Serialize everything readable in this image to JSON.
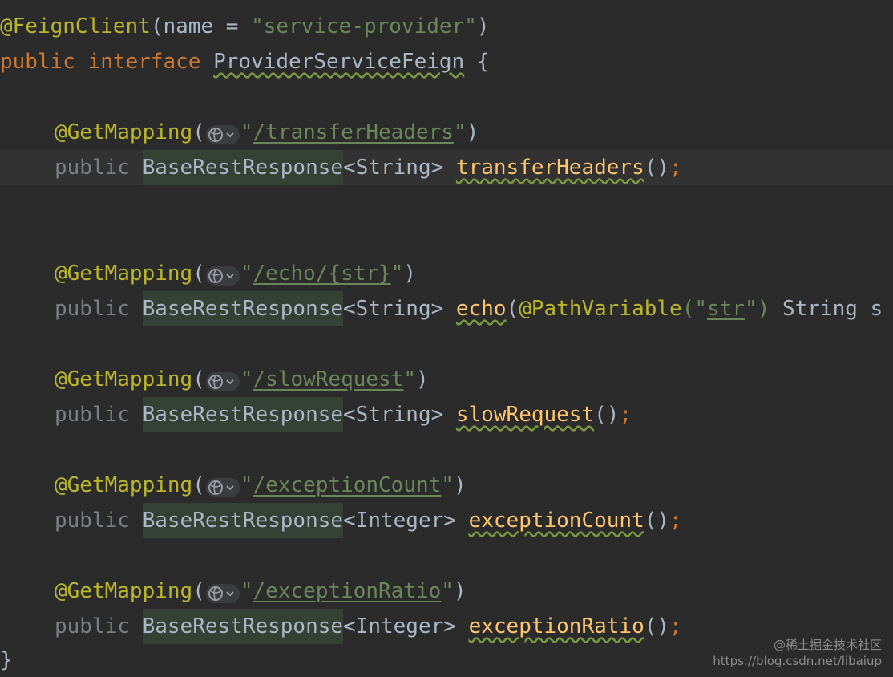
{
  "code": {
    "l1": {
      "anno": "@FeignClient",
      "open": "(",
      "param": "name",
      "eq": " = ",
      "value": "\"service-provider\"",
      "close": ")"
    },
    "l2": {
      "kw1": "public",
      "kw2": "interface",
      "name": "ProviderServiceFeign",
      "brace": " {"
    },
    "methods": [
      {
        "anno": "@GetMapping",
        "path_open": "\"",
        "path": "/transferHeaders",
        "path_close": "\"",
        "mod": "public",
        "ret": "BaseRestResponse",
        "generic": "<String>",
        "name": "transferHeaders",
        "args": "()",
        "semi": ";"
      },
      {
        "anno": "@GetMapping",
        "path_open": "\"",
        "path": "/echo/{str}",
        "path_close": "\"",
        "mod": "public",
        "ret": "BaseRestResponse",
        "generic": "<String>",
        "name": "echo",
        "args_open": "(",
        "param_anno": "@PathVariable",
        "param_q1": "(\"",
        "param_val": "str",
        "param_q2": "\")",
        "param_type": " String s"
      },
      {
        "anno": "@GetMapping",
        "path_open": "\"",
        "path": "/slowRequest",
        "path_close": "\"",
        "mod": "public",
        "ret": "BaseRestResponse",
        "generic": "<String>",
        "name": "slowRequest",
        "args": "()",
        "semi": ";"
      },
      {
        "anno": "@GetMapping",
        "path_open": "\"",
        "path": "/exceptionCount",
        "path_close": "\"",
        "mod": "public",
        "ret": "BaseRestResponse",
        "generic": "<Integer>",
        "name": "exceptionCount",
        "args": "()",
        "semi": ";"
      },
      {
        "anno": "@GetMapping",
        "path_open": "\"",
        "path": "/exceptionRatio",
        "path_close": "\"",
        "mod": "public",
        "ret": "BaseRestResponse",
        "generic": "<Integer>",
        "name": "exceptionRatio",
        "args": "()",
        "semi": ";"
      }
    ],
    "closing_brace": "}",
    "paren_open": "(",
    "paren_close": ")"
  },
  "watermark": {
    "line1": "@稀土掘金技术社区",
    "line2": "https://blog.csdn.net/libaiup"
  },
  "colors": {
    "background": "#2b2b2b",
    "keyword": "#cc7832",
    "annotation": "#bbb529",
    "string": "#6a8759",
    "method": "#ffc66d",
    "text": "#a9b7c6",
    "highlight": "#344134"
  },
  "icons": {
    "gutter_inlay": "globe-icon"
  }
}
